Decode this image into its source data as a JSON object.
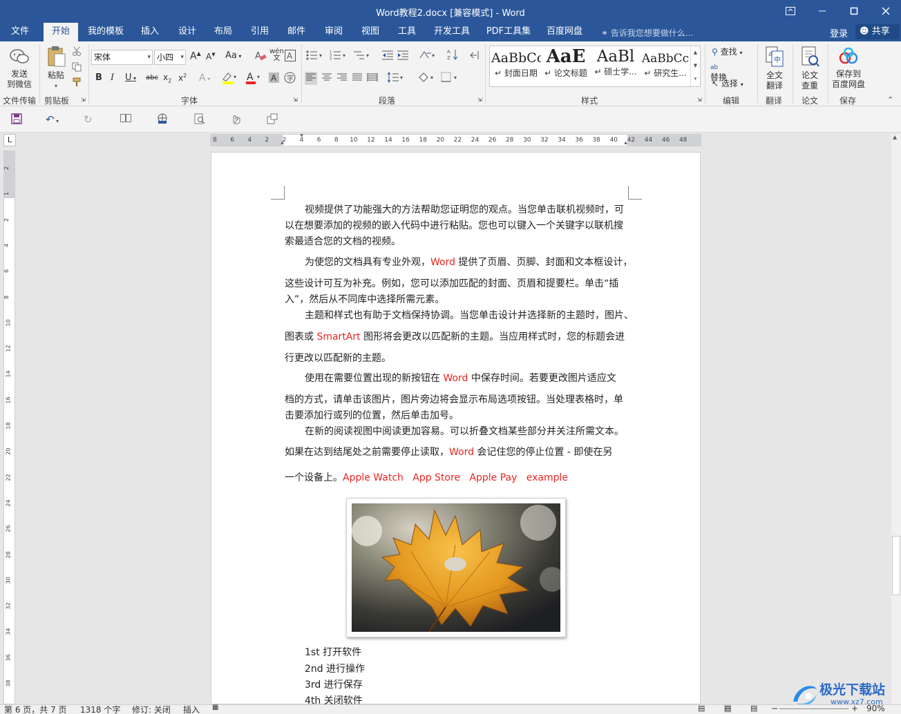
{
  "app": {
    "title": "Word教程2.docx [兼容模式] - Word",
    "window_buttons": [
      "ribbon-display",
      "minimize",
      "restore",
      "close"
    ]
  },
  "menu": {
    "tabs": [
      "文件",
      "开始",
      "我的模板",
      "插入",
      "设计",
      "布局",
      "引用",
      "邮件",
      "审阅",
      "视图",
      "工具",
      "开发工具",
      "PDF工具集",
      "百度网盘"
    ],
    "active": "开始",
    "tell_me": "告诉我您想要做什么...",
    "login": "登录",
    "share": "共享"
  },
  "ribbon": {
    "wechat": {
      "send_label": "发送\n到微信",
      "group": "文件传输"
    },
    "clipboard": {
      "paste_label": "粘贴",
      "group": "剪贴板"
    },
    "font": {
      "name": "宋体",
      "size": "小四",
      "group": "字体"
    },
    "paragraph": {
      "group": "段落"
    },
    "styles": {
      "items": [
        {
          "preview": "AaBbCc",
          "name": "封面日期"
        },
        {
          "preview": "AaE",
          "name": "论文标题"
        },
        {
          "preview": "AaBl",
          "name": "硕士学..."
        },
        {
          "preview": "AaBbCc",
          "name": "研究生..."
        }
      ],
      "group": "样式"
    },
    "editing": {
      "find": "查找",
      "replace": "替换",
      "select": "选择",
      "group": "编辑"
    },
    "translate": {
      "label": "全文\n翻译",
      "group": "翻译"
    },
    "paper": {
      "label": "论文\n查重",
      "group": "论文"
    },
    "save_cloud": {
      "label": "保存到\n百度网盘",
      "group": "保存"
    }
  },
  "ruler": {
    "numbers": [
      "8",
      "6",
      "4",
      "2",
      "2",
      "4",
      "6",
      "8",
      "10",
      "12",
      "14",
      "16",
      "18",
      "20",
      "22",
      "24",
      "26",
      "28",
      "30",
      "32",
      "34",
      "36",
      "38",
      "40",
      "42",
      "44",
      "46",
      "48"
    ],
    "vnumbers": [
      "2",
      "1",
      "2",
      "4",
      "6",
      "8",
      "10",
      "12",
      "14",
      "16",
      "18",
      "20",
      "22",
      "24",
      "26",
      "28",
      "30",
      "32",
      "34",
      "36",
      "38"
    ]
  },
  "document": {
    "paragraphs": [
      "视频提供了功能强大的方法帮助您证明您的观点。当您单击联机视频时，可",
      "以在想要添加的视频的嵌入代码中进行粘贴。您也可以键入一个关键字以联机搜",
      "索最适合您的文档的视频。",
      "为使您的文档具有专业外观，",
      "Word",
      " 提供了页眉、页脚、封面和文本框设计，",
      "这些设计可互为补充。例如，您可以添加匹配的封面、页眉和提要栏。单击“插",
      "入”，然后从不同库中选择所需元素。",
      "主题和样式也有助于文档保持协调。当您单击设计并选择新的主题时，图片、",
      "图表或 ",
      "SmartArt",
      " 图形将会更改以匹配新的主题。当应用样式时，您的标题会进",
      "行更改以匹配新的主题。",
      "使用在需要位置出现的新按钮在 ",
      "Word",
      " 中保存时间。若要更改图片适应文",
      "档的方式，请单击该图片，图片旁边将会显示布局选项按钮。当处理表格时，单",
      "击要添加行或列的位置，然后单击加号。",
      "在新的阅读视图中阅读更加容易。可以折叠文档某些部分并关注所需文本。",
      "如果在达到结尾处之前需要停止读取，",
      "Word",
      " 会记住您的停止位置 - 即使在另",
      "一个设备上。",
      "Apple Watch",
      "App Store",
      "Apple Pay",
      "example"
    ],
    "list": [
      "1st 打开软件",
      "2nd 进行操作",
      "3rd 进行保存",
      "4th 关闭软件"
    ],
    "image_alt": "autumn-leaf-photo"
  },
  "status": {
    "page": "第 6 页，共 7 页",
    "words": "1318 个字",
    "track": "修订: 关闭",
    "insert": "插入",
    "zoom": "90%"
  },
  "watermark": {
    "brand": "极光下载站",
    "url": "www.xz7.com"
  },
  "colors": {
    "brand": "#2b579a",
    "red_text": "#e8251f"
  }
}
